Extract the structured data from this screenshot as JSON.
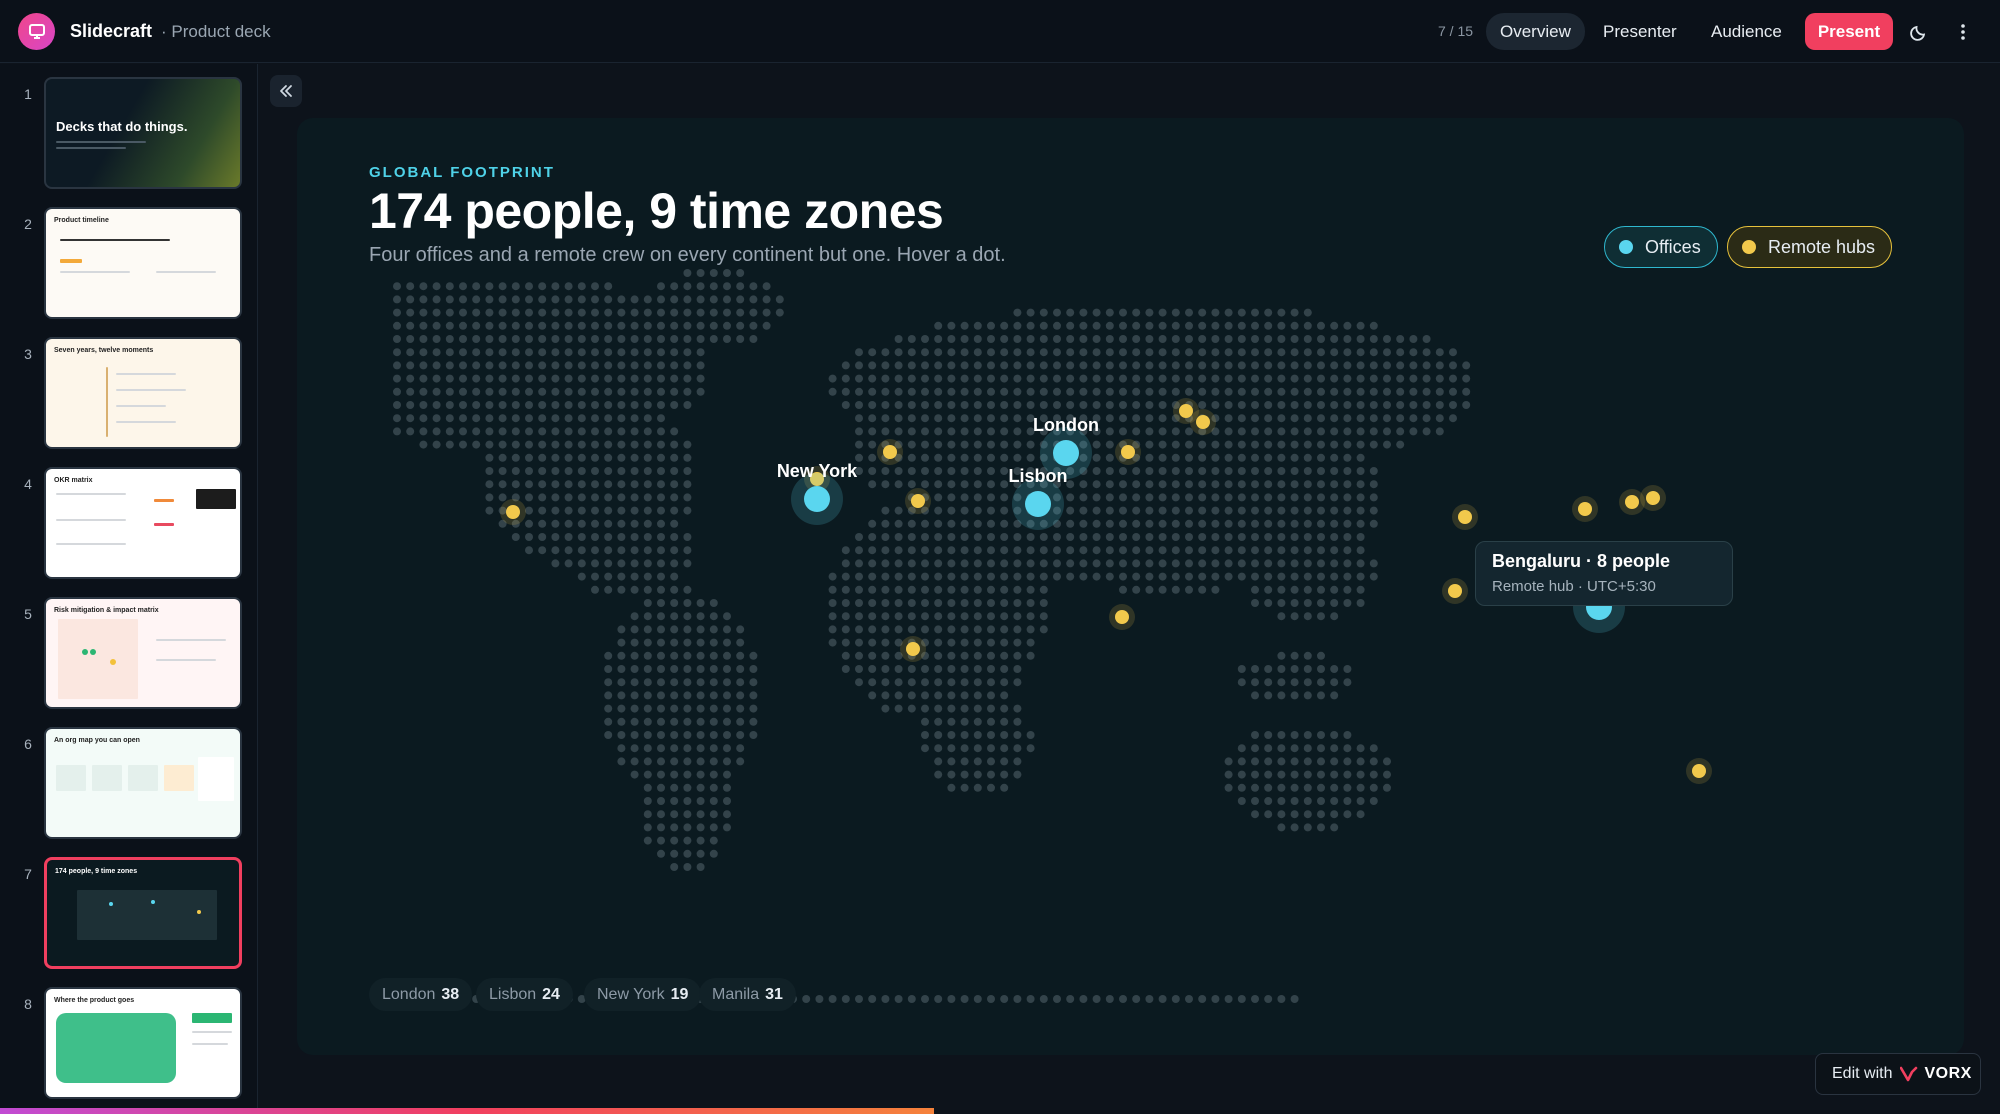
{
  "app": {
    "name": "Slidecraft",
    "document": "· Product deck",
    "page_counter": "7 / 15",
    "tabs": [
      "Overview",
      "Presenter",
      "Audience"
    ],
    "active_tab": "Overview",
    "present_label": "Present",
    "icons": [
      "presentation-logo-icon",
      "moon-icon",
      "more-vertical-icon",
      "collapse-left-icon"
    ]
  },
  "sidebar": {
    "slides": [
      {
        "num": "1",
        "title": "Decks that do things."
      },
      {
        "num": "2",
        "title": "Product timeline"
      },
      {
        "num": "3",
        "title": "Seven years, twelve moments"
      },
      {
        "num": "4",
        "title": "OKR matrix"
      },
      {
        "num": "5",
        "title": "Risk mitigation & impact matrix"
      },
      {
        "num": "6",
        "title": "An org map you can open"
      },
      {
        "num": "7",
        "title": "174 people, 9 time zones"
      },
      {
        "num": "8",
        "title": "Where the product goes"
      }
    ],
    "active": "7"
  },
  "slide": {
    "eyebrow": "GLOBAL FOOTPRINT",
    "headline": "174 people, 9 time zones",
    "subtitle": "Four offices and a remote crew on every continent but one. Hover a dot.",
    "legend": {
      "offices": "Offices",
      "remote": "Remote hubs"
    },
    "colors": {
      "office": "#5ad6ef",
      "remote": "#f2c94c",
      "accent": "#f13f5f",
      "background": "#0b1a20"
    },
    "map_labels": {
      "new_york": "New York",
      "london": "London",
      "lisbon": "Lisbon"
    },
    "tooltip": {
      "title": "Bengaluru · 8 people",
      "subtitle": "Remote hub · UTC+5:30"
    },
    "stats": [
      {
        "city": "London",
        "count": "38"
      },
      {
        "city": "Lisbon",
        "count": "24"
      },
      {
        "city": "New York",
        "count": "19"
      },
      {
        "city": "Manila",
        "count": "31"
      }
    ]
  },
  "footer": {
    "edit_label": "Edit with",
    "brand": "VORX"
  }
}
